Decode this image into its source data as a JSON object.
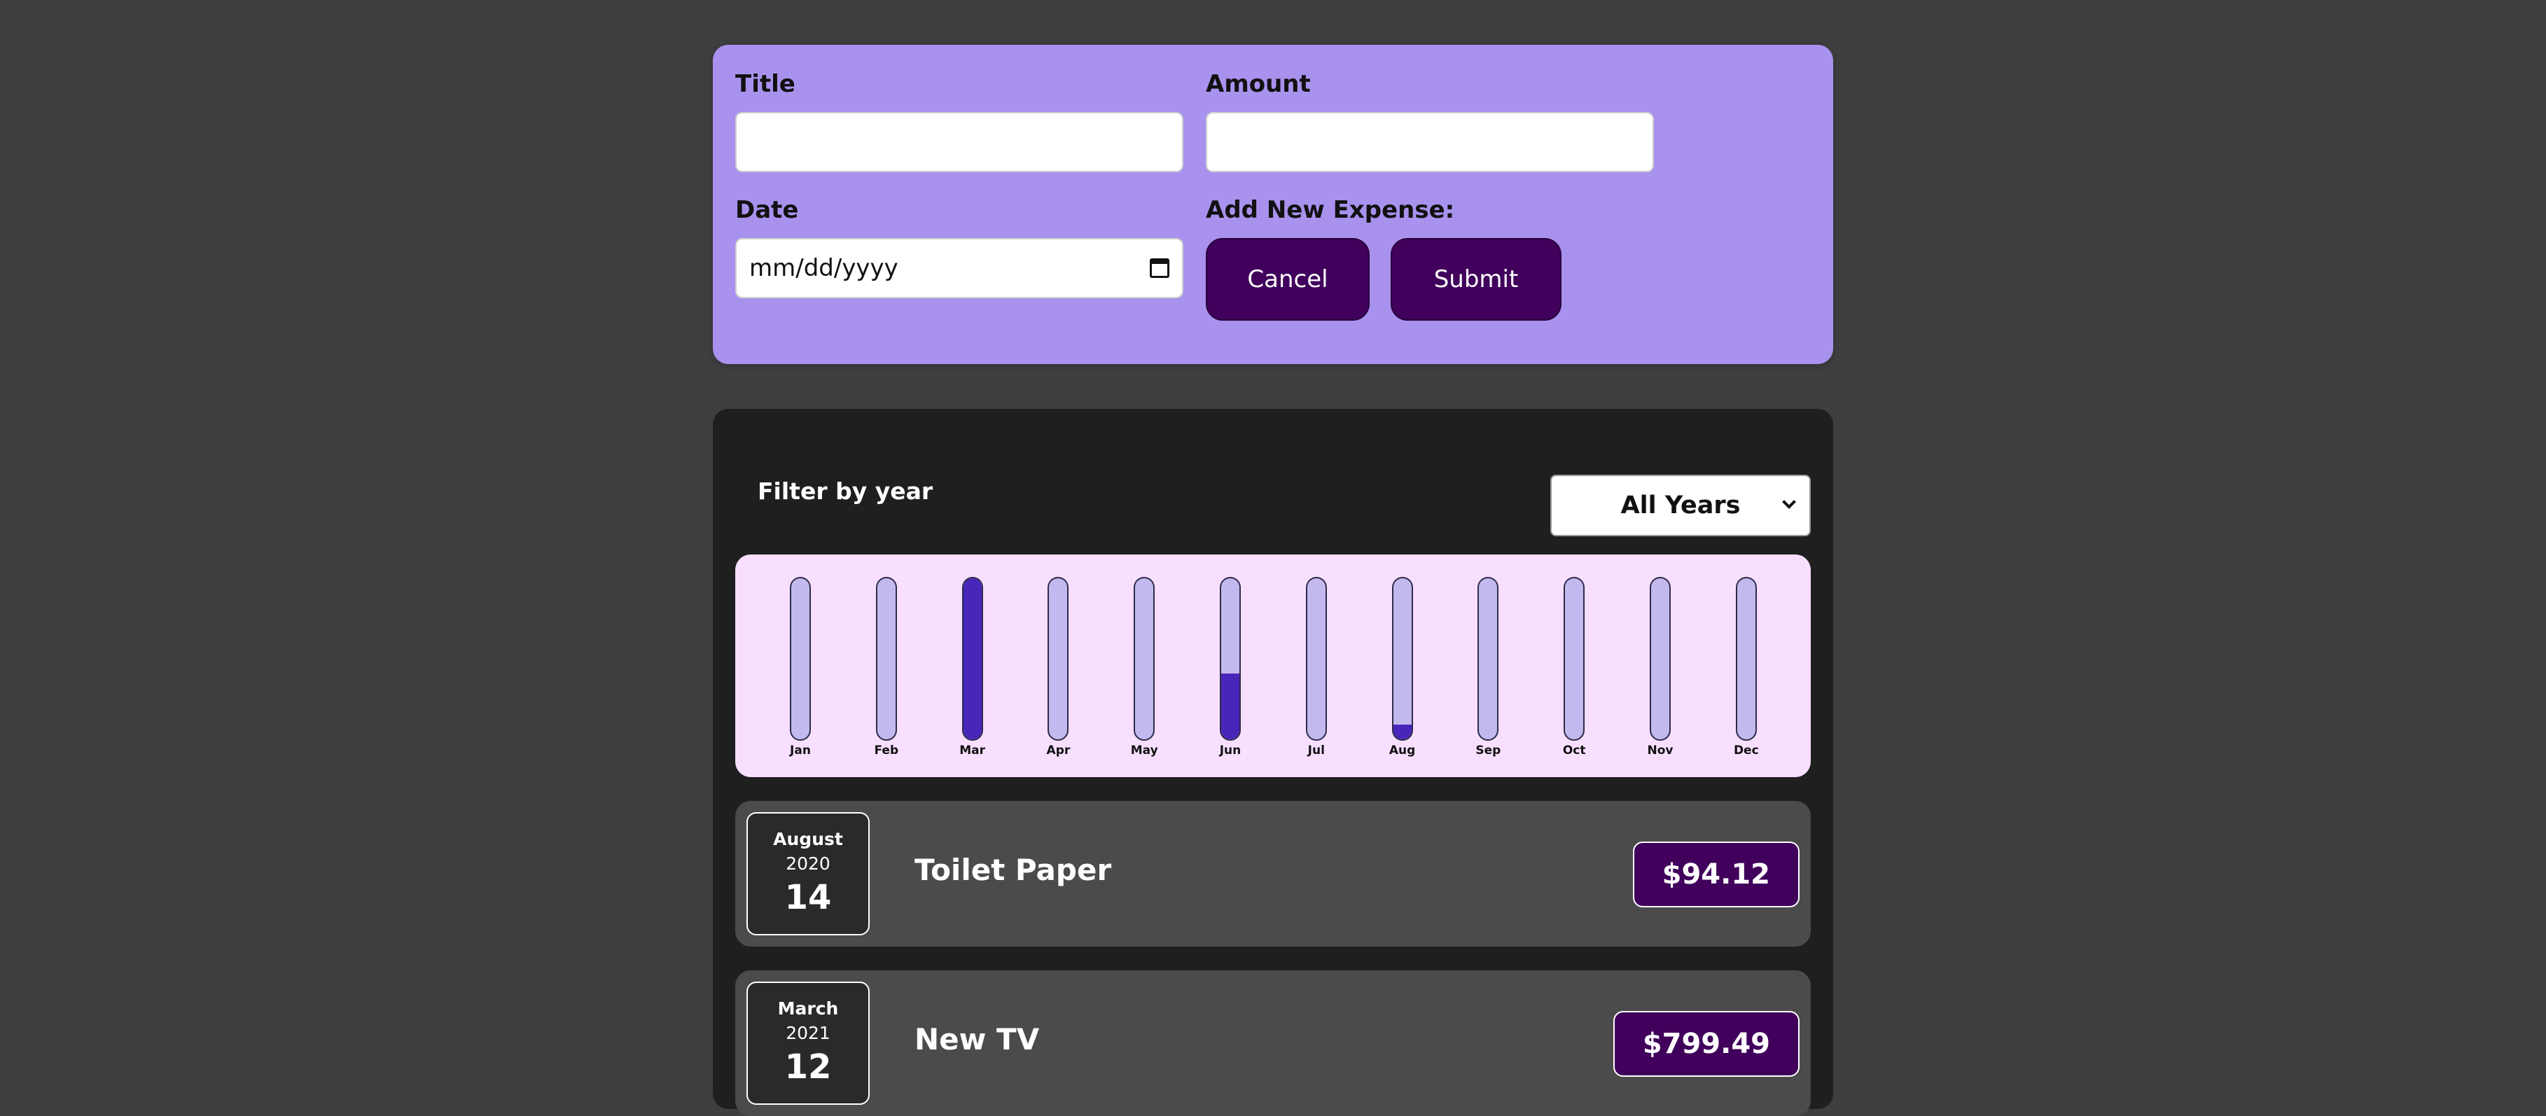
{
  "form": {
    "title_label": "Title",
    "amount_label": "Amount",
    "date_label": "Date",
    "date_placeholder": "mm/dd/yyyy",
    "add_new_label": "Add New Expense:",
    "cancel_label": "Cancel",
    "submit_label": "Submit"
  },
  "filter": {
    "label": "Filter by year",
    "selected": "All Years"
  },
  "chart_data": {
    "type": "bar",
    "categories": [
      "Jan",
      "Feb",
      "Mar",
      "Apr",
      "May",
      "Jun",
      "Jul",
      "Aug",
      "Sep",
      "Oct",
      "Nov",
      "Dec"
    ],
    "values": [
      0,
      0,
      1.0,
      0,
      0,
      0.41,
      0,
      0.09,
      0,
      0,
      0,
      0
    ],
    "fill_color": "#4826b9",
    "empty_color": "#c3b9ee"
  },
  "expenses": [
    {
      "month": "August",
      "year": "2020",
      "day": "14",
      "title": "Toilet Paper",
      "amount": "$94.12"
    },
    {
      "month": "March",
      "year": "2021",
      "day": "12",
      "title": "New TV",
      "amount": "$799.49"
    }
  ],
  "colors": {
    "page_bg": "#3f3f3f",
    "form_bg": "#a892ee",
    "button_bg": "#40005c",
    "card_bg": "#1f1f1f",
    "chart_bg": "#f8dfff",
    "item_bg": "#4b4b4b"
  }
}
